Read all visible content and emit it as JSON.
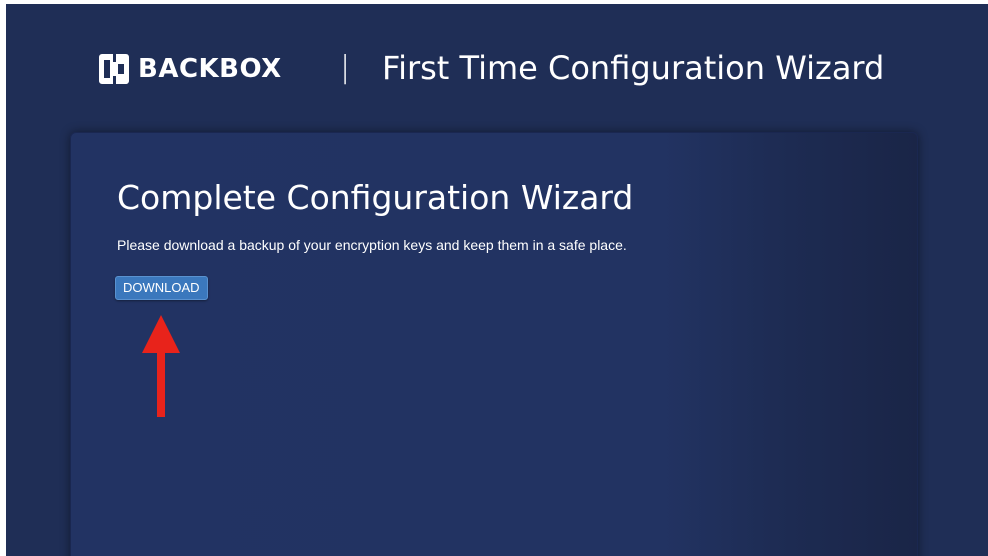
{
  "header": {
    "logo_text": "BACKBOX",
    "separator": "|",
    "title": "First Time Configuration Wizard"
  },
  "panel": {
    "title": "Complete Configuration Wizard",
    "message": "Please download a backup of your encryption keys and keep them in a safe place.",
    "download_label": "DOWNLOAD"
  },
  "icons": {
    "logo": "backbox-logo-icon",
    "annotation": "red-arrow-icon"
  },
  "colors": {
    "background": "#1f2e56",
    "panel": "#223363",
    "button": "#3b78bd",
    "arrow": "#e8231b"
  }
}
